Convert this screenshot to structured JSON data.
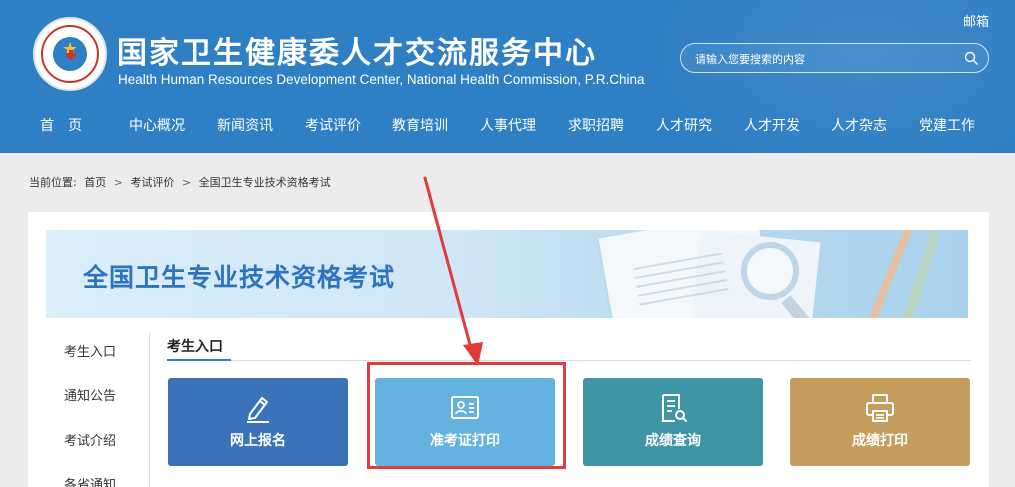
{
  "header": {
    "title": "国家卫生健康委人才交流服务中心",
    "subtitle": "Health Human Resources Development Center, National Health Commission, P.R.China",
    "mailbox": "邮箱",
    "search_placeholder": "请输入您要搜索的内容",
    "logo_icon": "ministry-seal-icon"
  },
  "nav": {
    "items": [
      "首　页",
      "中心概况",
      "新闻资讯",
      "考试评价",
      "教育培训",
      "人事代理",
      "求职招聘",
      "人才研究",
      "人才开发",
      "人才杂志",
      "党建工作"
    ]
  },
  "breadcrumb": {
    "prefix": "当前位置:",
    "items": [
      "首页",
      "考试评价",
      "全国卫生专业技术资格考试"
    ],
    "separator": ">"
  },
  "banner": {
    "title": "全国卫生专业技术资格考试"
  },
  "sidebar": {
    "items": [
      "考生入口",
      "通知公告",
      "考试介绍",
      "各省通知"
    ]
  },
  "section": {
    "title": "考生入口"
  },
  "cards": [
    {
      "label": "网上报名",
      "icon": "pen-icon",
      "color": "#3a73b9"
    },
    {
      "label": "准考证打印",
      "icon": "id-card-icon",
      "color": "#64b2e0"
    },
    {
      "label": "成绩查询",
      "icon": "document-search-icon",
      "color": "#3f94a6"
    },
    {
      "label": "成绩打印",
      "icon": "printer-icon",
      "color": "#c49c5c"
    }
  ],
  "colors": {
    "header_bg": "#2f7fc4",
    "annotation": "#e23b3b"
  }
}
